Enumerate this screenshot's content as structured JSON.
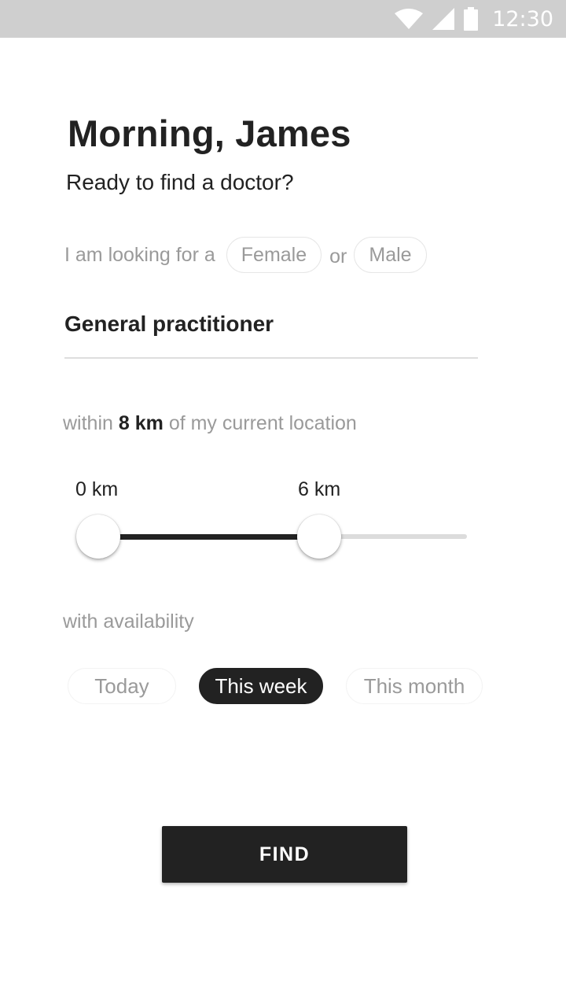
{
  "status_bar": {
    "time": "12:30",
    "icons": [
      "wifi-icon",
      "cell-signal-icon",
      "battery-icon"
    ]
  },
  "header": {
    "greeting": "Morning, James",
    "subtitle": "Ready to find a doctor?"
  },
  "gender": {
    "prefix": "I am looking for a",
    "options": [
      "Female",
      "Male"
    ],
    "separator": "or"
  },
  "specialty": {
    "value": "General practitioner"
  },
  "distance": {
    "prefix": "within",
    "value": "8 km",
    "suffix": "of my current location",
    "slider": {
      "min_label": "0 km",
      "max_label": "6 km",
      "min_value_km": 0,
      "max_value_km": 6,
      "scale_max_km": 10
    }
  },
  "availability": {
    "label": "with availability",
    "options": [
      "Today",
      "This week",
      "This month"
    ],
    "selected": "This week"
  },
  "actions": {
    "find_label": "FIND"
  },
  "colors": {
    "primary": "#222222",
    "muted_text": "#9a9a9a",
    "status_bar": "#cfcfcf",
    "track": "#dcdcdc"
  }
}
